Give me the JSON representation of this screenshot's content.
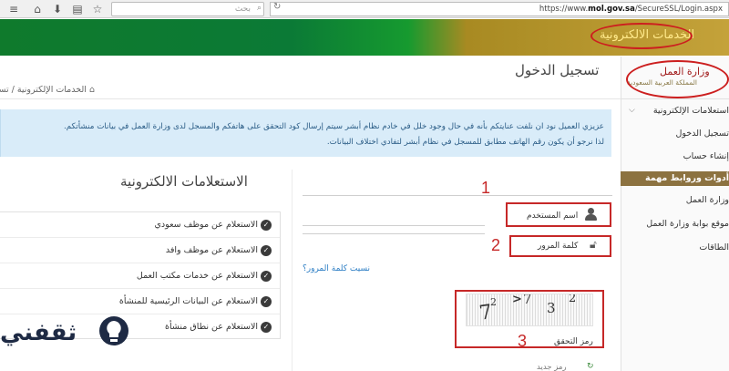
{
  "browser": {
    "search_placeholder": "بحث",
    "url_prefix": "https://www.",
    "url_domain": "mol.gov.sa",
    "url_path": "/SecureSSL/Login.aspx"
  },
  "banner": {
    "title": "الخدمات الالكترونية"
  },
  "sidebar": {
    "ministry_name": "وزارة العمل",
    "ministry_subtitle": "المملكة العربية السعودية",
    "items": [
      "استعلامات الإلكترونية",
      "تسجيل الدخول",
      "إنشاء حساب"
    ],
    "links_header": "أدوات وروابط مهمة",
    "links": [
      "وزارة العمل",
      "موقع بوابة وزارة العمل",
      "الطاقات"
    ]
  },
  "page": {
    "title": "تسجيل الدخول",
    "breadcrumb": "الخدمات الإلكترونية / تسـ"
  },
  "alert": {
    "line1": "عزيزي العميل نود ان نلفت عنايتكم بأنه في حال وجود خلل في خادم نظام أبشر سيتم إرسال كود التحقق على هاتفكم والمسجل لدى وزارة العمل في بيانات منشأتكم.",
    "line2": "لذا نرجو أن يكون رقم الهاتف مطابق للمسجل في نظام أبشر لتفادي اختلاف البيانات."
  },
  "login": {
    "username_label": "اسم المستخدم",
    "password_label": "كلمة المرور",
    "forgot_link": "نسيت كلمة المرور؟",
    "captcha_label": "رمز التحقق",
    "captcha_chars": [
      "7",
      "2",
      ">",
      "7",
      "3",
      "2"
    ],
    "new_code": "رمز جديد",
    "annotations": [
      "1",
      "2",
      "3"
    ]
  },
  "inquiries": {
    "title": "الاستعلامات الالكترونية",
    "items": [
      "الاستعلام عن موظف سعودي",
      "الاستعلام عن موظف وافد",
      "الاستعلام عن خدمات مكتب العمل",
      "الاستعلام عن البيانات الرئيسية للمنشأة",
      "الاستعلام عن نطاق منشأة"
    ]
  },
  "watermark": {
    "text": "ثقفني"
  },
  "colors": {
    "banner_green": "#0f7a2c",
    "banner_gold": "#c4a23a",
    "annotation_red": "#c62828",
    "alert_bg": "#d9ecf9",
    "sidebar_header": "#8c7240"
  }
}
